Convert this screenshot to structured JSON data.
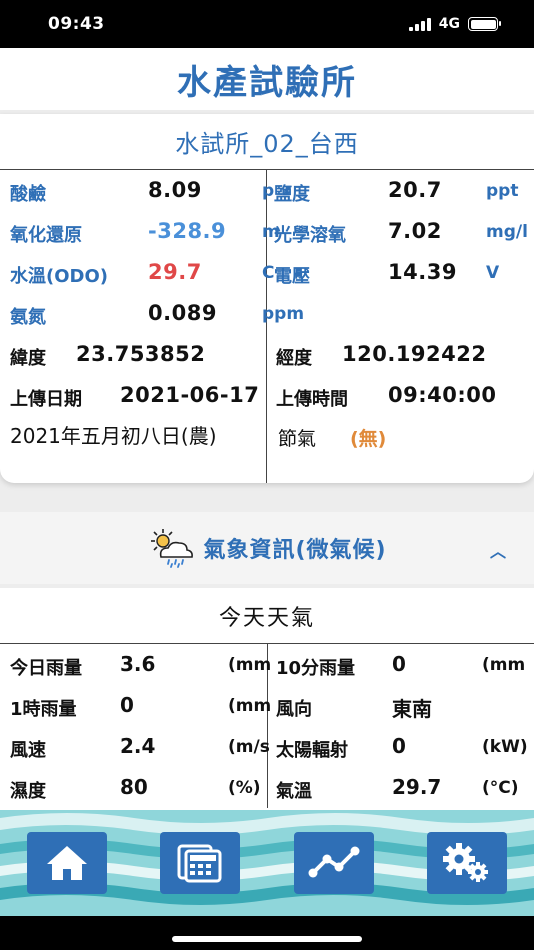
{
  "status_bar": {
    "time": "09:43",
    "network": "4G"
  },
  "header": {
    "title": "水產試驗所"
  },
  "station": {
    "name": "水試所_02_台西",
    "readings": [
      {
        "label": "酸鹼",
        "value": "8.09",
        "unit": "p"
      },
      {
        "label": "鹽度",
        "value": "20.7",
        "unit": "ppt"
      },
      {
        "label": "氧化還原",
        "value": "-328.9",
        "unit": "m"
      },
      {
        "label": "光學溶氧",
        "value": "7.02",
        "unit": "mg/l"
      },
      {
        "label": "水溫(ODO)",
        "value": "29.7",
        "unit": "C"
      },
      {
        "label": "電壓",
        "value": "14.39",
        "unit": "V"
      },
      {
        "label": "氨氮",
        "value": "0.089",
        "unit": "ppm"
      }
    ],
    "latitude_label": "緯度",
    "latitude": "23.753852",
    "longitude_label": "經度",
    "longitude": "120.192422",
    "upload_date_label": "上傳日期",
    "upload_date": "2021-06-17",
    "upload_time_label": "上傳時間",
    "upload_time": "09:40:00",
    "lunar_date": "2021年五月初八日(農)",
    "solar_term_label": "節氣",
    "solar_term": "(無)"
  },
  "weather": {
    "title": "氣象資訊(微氣候)",
    "subtitle": "今天天氣",
    "rows": [
      {
        "label": "今日雨量",
        "value": "3.6",
        "unit": "(mm"
      },
      {
        "label": "10分雨量",
        "value": "0",
        "unit": "(mm"
      },
      {
        "label": "1時雨量",
        "value": "0",
        "unit": "(mm"
      },
      {
        "label": "風向",
        "value": "東南",
        "unit": ""
      },
      {
        "label": "風速",
        "value": "2.4",
        "unit": "(m/s"
      },
      {
        "label": "太陽輻射",
        "value": "0",
        "unit": "(kW)"
      },
      {
        "label": "濕度",
        "value": "80",
        "unit": "(%)"
      },
      {
        "label": "氣溫",
        "value": "29.7",
        "unit": "(°C)"
      }
    ]
  },
  "tabs": [
    {
      "icon": "home-icon"
    },
    {
      "icon": "calculator-icon"
    },
    {
      "icon": "chart-line-icon"
    },
    {
      "icon": "gears-icon"
    }
  ],
  "colors": {
    "brand_blue": "#2f6fb6",
    "value_blue": "#4a90d9",
    "value_red": "#e04848",
    "accent_orange": "#e08a3a"
  }
}
